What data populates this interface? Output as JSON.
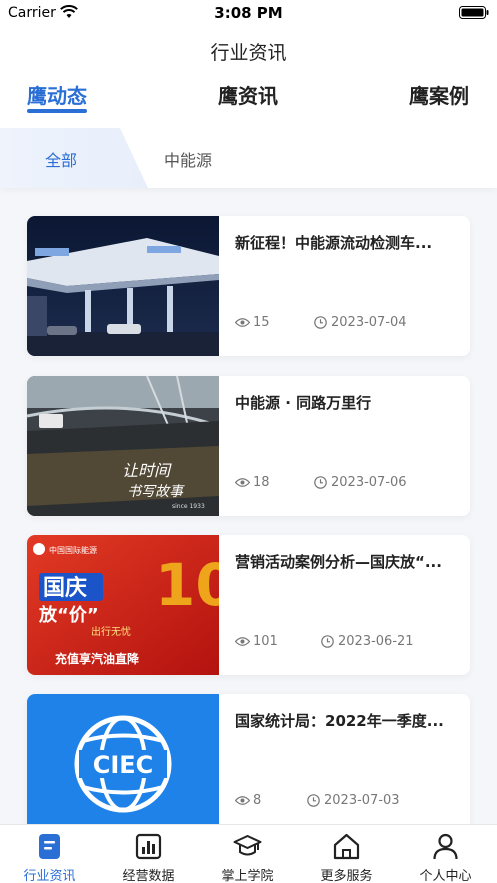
{
  "status_bar": {
    "carrier": "Carrier",
    "time": "3:08 PM"
  },
  "header": {
    "title": "行业资讯"
  },
  "main_tabs": [
    {
      "label": "鹰动态",
      "active": true
    },
    {
      "label": "鹰资讯",
      "active": false
    },
    {
      "label": "鹰案例",
      "active": false
    }
  ],
  "sub_tabs": [
    {
      "label": "全部",
      "active": true
    },
    {
      "label": "中能源",
      "active": false
    }
  ],
  "articles": [
    {
      "title": "新征程！中能源流动检测车...",
      "views": "15",
      "date": "2023-07-04",
      "image": "gas-station-night"
    },
    {
      "title": "中能源 · 同路万里行",
      "views": "18",
      "date": "2023-07-06",
      "image": "bridge-road-calligraphy",
      "image_text": "让时间 书写故事"
    },
    {
      "title": "营销活动案例分析—国庆放“...",
      "views": "101",
      "date": "2023-06-21",
      "image": "national-day-promo",
      "image_text": {
        "brand": "中国国际能源",
        "headline": "国庆",
        "sub": "放“价”",
        "slogan": "出行无忧",
        "banner": "充值享汽油直降"
      }
    },
    {
      "title": "国家统计局：2022年一季度...",
      "views": "8",
      "date": "2023-07-03",
      "image": "ciec-logo",
      "image_text": "CIEC"
    }
  ],
  "tabbar": [
    {
      "label": "行业资讯",
      "icon": "news-icon",
      "active": true
    },
    {
      "label": "经营数据",
      "icon": "bar-chart-icon",
      "active": false
    },
    {
      "label": "掌上学院",
      "icon": "graduation-cap-icon",
      "active": false
    },
    {
      "label": "更多服务",
      "icon": "home-icon",
      "active": false
    },
    {
      "label": "个人中心",
      "icon": "user-icon",
      "active": false
    }
  ],
  "colors": {
    "accent": "#2a6fd6",
    "background": "#f4f6fa",
    "promo_red": "#d8211a"
  }
}
